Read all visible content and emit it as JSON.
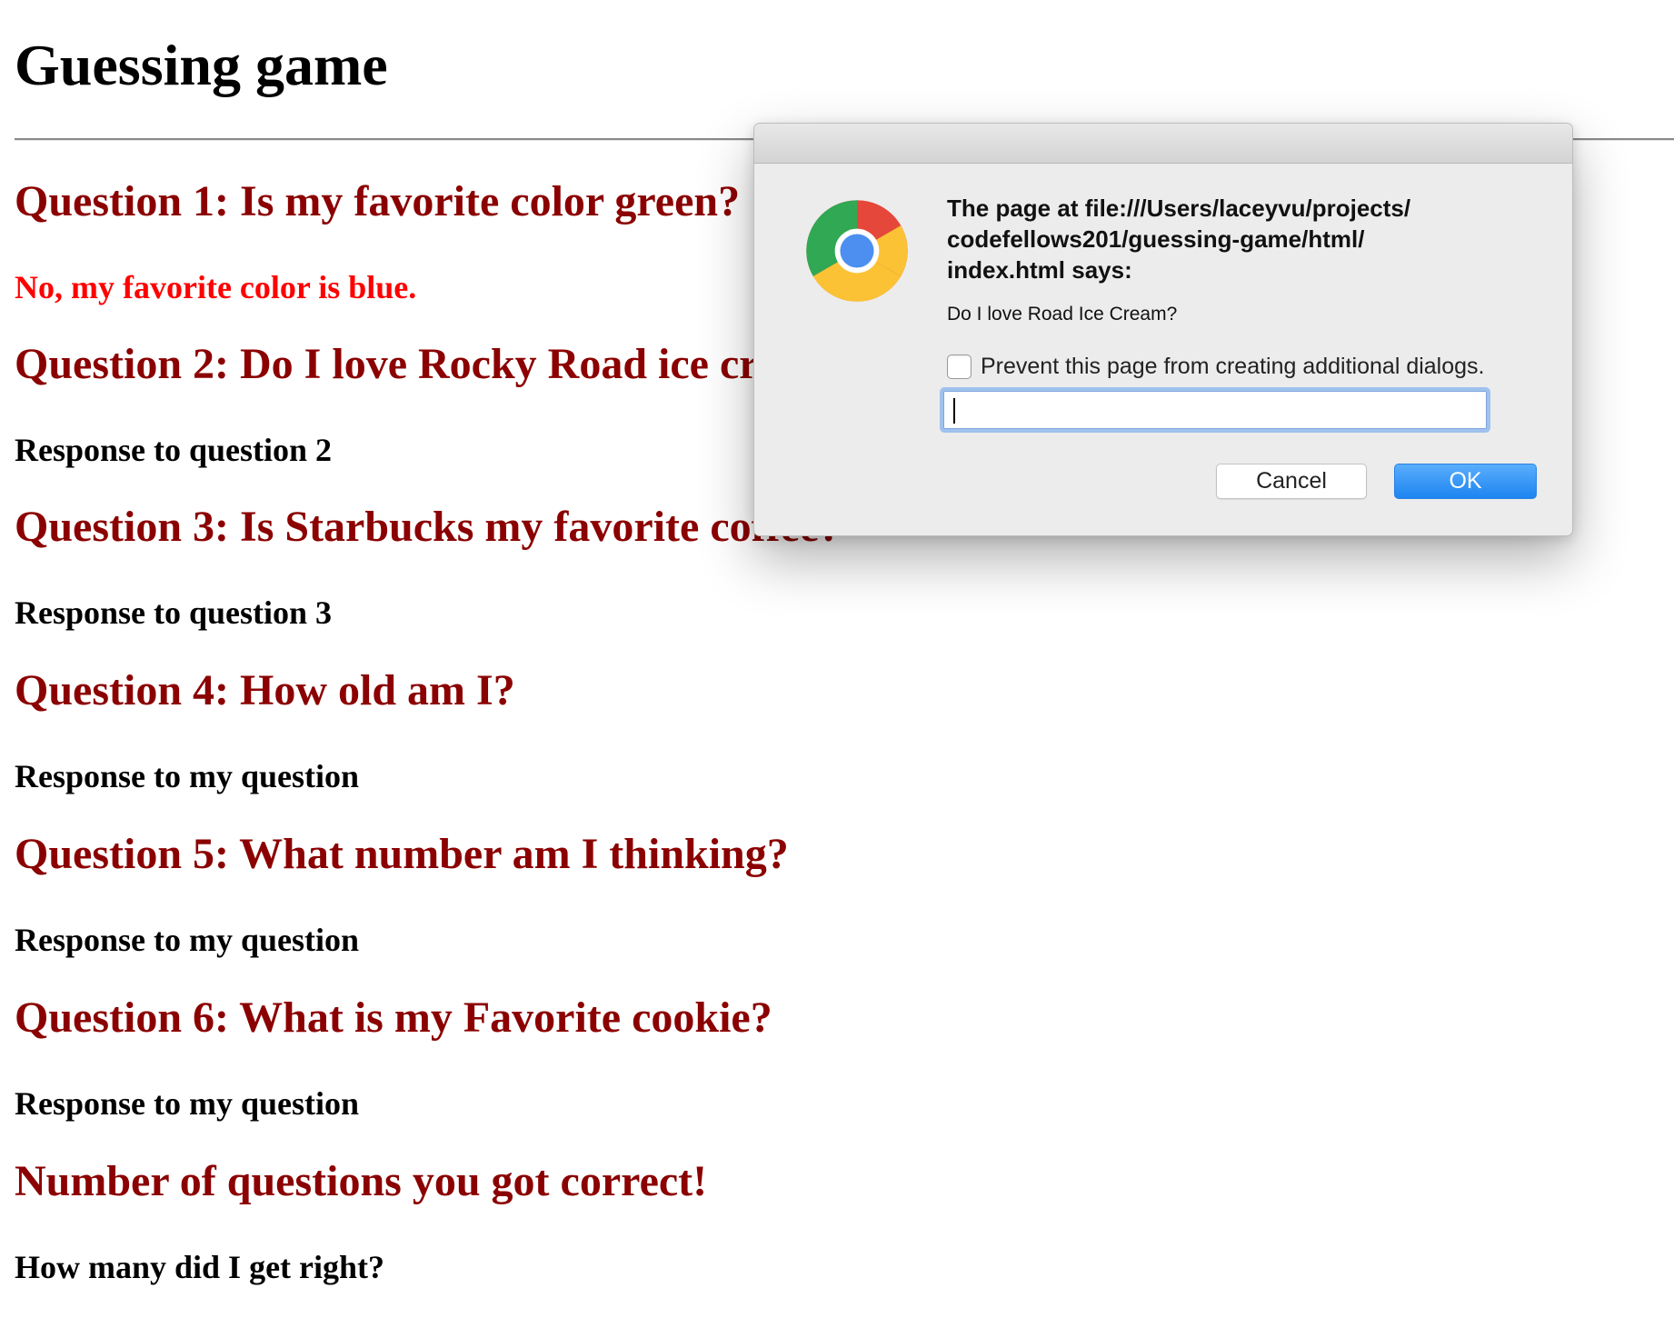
{
  "colors": {
    "question_red": "#8b0000",
    "wrong_answer_red": "#ff0000",
    "answer_text": "#000000",
    "ok_button_blue": "#1d84f0"
  },
  "page": {
    "title": "Guessing game",
    "sections": [
      {
        "question": "Question 1: Is my favorite color green?",
        "response": "No, my favorite color is blue."
      },
      {
        "question": "Question 2: Do I love Rocky Road ice cream?",
        "response": "Response to question 2"
      },
      {
        "question": "Question 3: Is Starbucks my favorite coffee?",
        "response": "Response to question 3"
      },
      {
        "question": "Question 4: How old am I?",
        "response": "Response to my question"
      },
      {
        "question": "Question 5: What number am I thinking?",
        "response": "Response to my question"
      },
      {
        "question": "Question 6: What is my Favorite cookie?",
        "response": "Response to my question"
      },
      {
        "question": "Number of questions you got correct!",
        "response": "How many did I get right?"
      }
    ]
  },
  "dialog": {
    "message_title": "The page at file:///Users/laceyvu/projects/\ncodefellows201/guessing-game/html/\nindex.html says:",
    "prompt": "Do I love Road Ice Cream?",
    "checkbox_label": "Prevent this page from creating additional dialogs.",
    "checkbox_checked": false,
    "input_value": "",
    "cancel_label": "Cancel",
    "ok_label": "OK",
    "logo_icon": "chrome-logo-icon"
  }
}
